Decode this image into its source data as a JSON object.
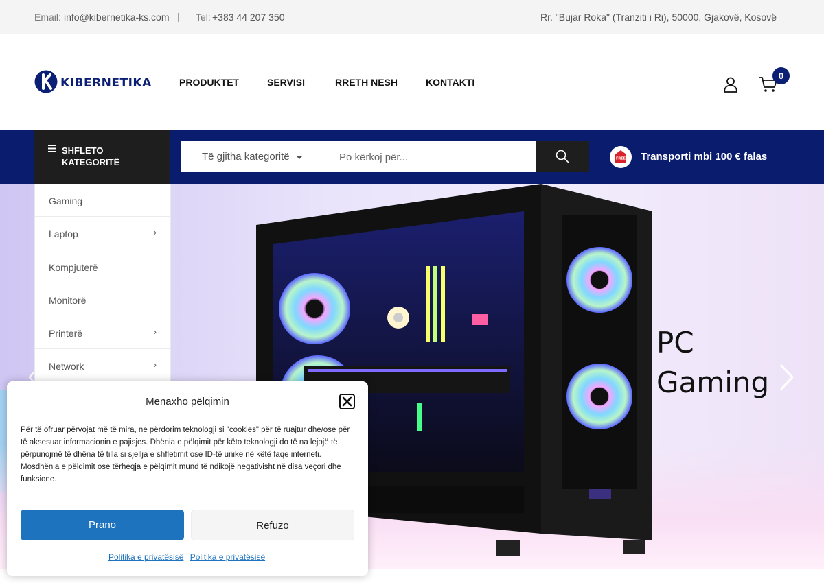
{
  "topbar": {
    "email_label": "Email:",
    "email": "info@kibernetika-ks.com",
    "separator": "|",
    "tel_label": "Tel:",
    "tel": "+383 44 207 350",
    "address": "Rr. \"Bujar Roka\" (Tranziti i Ri), 50000, Gjakovë, Kosovë"
  },
  "brand": {
    "name": "KIBERNETIKA",
    "color": "#0b1f74"
  },
  "nav": {
    "items": [
      {
        "label": "PRODUKTET"
      },
      {
        "label": "SERVISI"
      },
      {
        "label": "RRETH NESH"
      },
      {
        "label": "KONTAKTI"
      }
    ]
  },
  "cart": {
    "count": "0"
  },
  "browse": {
    "label": "SHFLETO KATEGORITË"
  },
  "search": {
    "category": "Të gjitha kategoritë",
    "placeholder": "Po kërkoj për...",
    "value": ""
  },
  "shipping": {
    "badge_text": "FREE",
    "text": "Transporti mbi 100 € falas"
  },
  "categories": [
    {
      "label": "Gaming",
      "has_children": false
    },
    {
      "label": "Laptop",
      "has_children": true
    },
    {
      "label": "Kompjuterë",
      "has_children": false
    },
    {
      "label": "Monitorë",
      "has_children": false
    },
    {
      "label": "Printerë",
      "has_children": true
    },
    {
      "label": "Network",
      "has_children": true
    }
  ],
  "hero": {
    "title_line1": "PC",
    "title_line2": "Gaming"
  },
  "cookie": {
    "title": "Menaxho pëlqimin",
    "body": "Për të ofruar përvojat më të mira, ne përdorim teknologji si \"cookies\" për të ruajtur dhe/ose për të aksesuar informacionin e pajisjes. Dhënia e pëlqimit për këto teknologji do të na lejojë të përpunojmë të dhëna të tilla si sjellja e shfletimit ose ID-të unike në këtë faqe interneti. Mosdhënia e pëlqimit ose tërheqja e pëlqimit mund të ndikojë negativisht në disa veçori dhe funksione.",
    "accept_label": "Prano",
    "refuse_label": "Refuzo",
    "link1": "Politika e privatësisë",
    "link2": "Politika e privatësisë",
    "accept_color": "#1e73be"
  }
}
